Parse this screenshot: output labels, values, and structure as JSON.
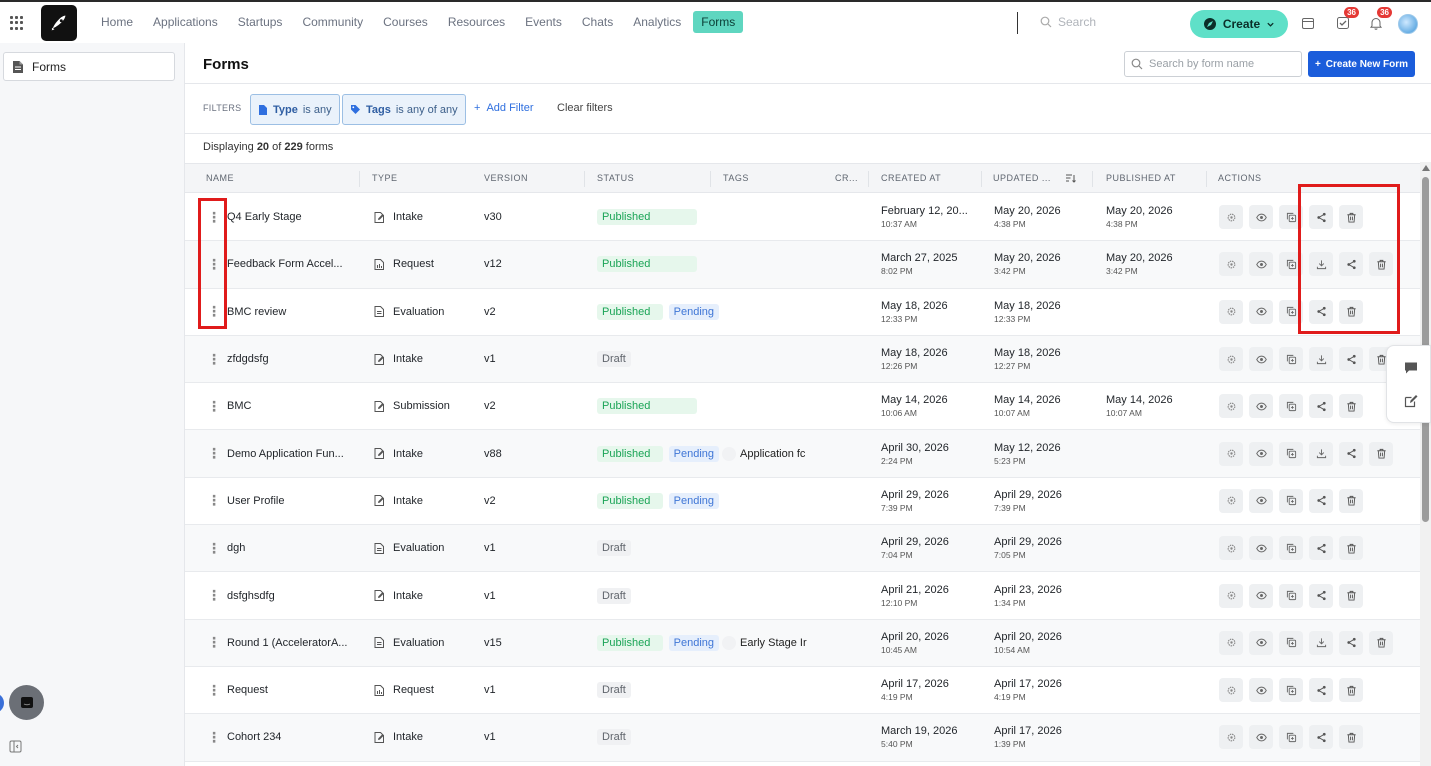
{
  "topbar": {
    "nav": [
      "Home",
      "Applications",
      "Startups",
      "Community",
      "Courses",
      "Resources",
      "Events",
      "Chats",
      "Analytics",
      "Forms"
    ],
    "active_nav": "Forms",
    "search_placeholder": "Search",
    "create_label": "Create",
    "tasks_badge": "36",
    "notifications_badge": "36"
  },
  "sidebar": {
    "items": [
      {
        "label": "Forms"
      }
    ]
  },
  "page": {
    "title": "Forms",
    "search_placeholder": "Search by form name",
    "create_new_label": "Create New Form"
  },
  "filters": {
    "label": "FILTERS",
    "type_key": "Type",
    "type_rest": "is any",
    "tags_key": "Tags",
    "tags_rest": "is any of any",
    "add_filter": "Add Filter",
    "clear_filters": "Clear filters"
  },
  "display": {
    "prefix": "Displaying",
    "shown": "20",
    "of": "of",
    "total": "229",
    "suffix": "forms"
  },
  "columns": [
    "NAME",
    "TYPE",
    "VERSION",
    "STATUS",
    "TAGS",
    "CR...",
    "CREATED AT",
    "UPDATED ...",
    "PUBLISHED AT",
    "ACTIONS"
  ],
  "rows": [
    {
      "name": "Q4 Early Stage",
      "type": "Intake",
      "version": "v30",
      "status": [
        "Published"
      ],
      "tag": "",
      "created": [
        "February 12, 20...",
        "10:37 AM"
      ],
      "updated": [
        "May 20, 2026",
        "4:38 PM"
      ],
      "published": [
        "May 20, 2026",
        "4:38 PM"
      ],
      "download": false
    },
    {
      "name": "Feedback Form Accel...",
      "type": "Request",
      "version": "v12",
      "status": [
        "Published"
      ],
      "tag": "",
      "created": [
        "March 27, 2025",
        "8:02 PM"
      ],
      "updated": [
        "May 20, 2026",
        "3:42 PM"
      ],
      "published": [
        "May 20, 2026",
        "3:42 PM"
      ],
      "download": true
    },
    {
      "name": "BMC review",
      "type": "Evaluation",
      "version": "v2",
      "status": [
        "Published",
        "Pending"
      ],
      "tag": "",
      "created": [
        "May 18, 2026",
        "12:33 PM"
      ],
      "updated": [
        "May 18, 2026",
        "12:33 PM"
      ],
      "published": [
        "",
        ""
      ],
      "download": false
    },
    {
      "name": "zfdgdsfg",
      "type": "Intake",
      "version": "v1",
      "status": [
        "Draft"
      ],
      "tag": "",
      "created": [
        "May 18, 2026",
        "12:26 PM"
      ],
      "updated": [
        "May 18, 2026",
        "12:27 PM"
      ],
      "published": [
        "",
        ""
      ],
      "download": true
    },
    {
      "name": "BMC",
      "type": "Submission",
      "version": "v2",
      "status": [
        "Published"
      ],
      "tag": "",
      "created": [
        "May 14, 2026",
        "10:06 AM"
      ],
      "updated": [
        "May 14, 2026",
        "10:07 AM"
      ],
      "published": [
        "May 14, 2026",
        "10:07 AM"
      ],
      "download": false
    },
    {
      "name": "Demo Application Fun...",
      "type": "Intake",
      "version": "v88",
      "status": [
        "Published",
        "Pending"
      ],
      "tag": "Application fc",
      "created": [
        "April 30, 2026",
        "2:24 PM"
      ],
      "updated": [
        "May 12, 2026",
        "5:23 PM"
      ],
      "published": [
        "",
        ""
      ],
      "download": true
    },
    {
      "name": "User Profile",
      "type": "Intake",
      "version": "v2",
      "status": [
        "Published",
        "Pending"
      ],
      "tag": "",
      "created": [
        "April 29, 2026",
        "7:39 PM"
      ],
      "updated": [
        "April 29, 2026",
        "7:39 PM"
      ],
      "published": [
        "",
        ""
      ],
      "download": false
    },
    {
      "name": "dgh",
      "type": "Evaluation",
      "version": "v1",
      "status": [
        "Draft"
      ],
      "tag": "",
      "created": [
        "April 29, 2026",
        "7:04 PM"
      ],
      "updated": [
        "April 29, 2026",
        "7:05 PM"
      ],
      "published": [
        "",
        ""
      ],
      "download": false
    },
    {
      "name": "dsfghsdfg",
      "type": "Intake",
      "version": "v1",
      "status": [
        "Draft"
      ],
      "tag": "",
      "created": [
        "April 21, 2026",
        "12:10 PM"
      ],
      "updated": [
        "April 23, 2026",
        "1:34 PM"
      ],
      "published": [
        "",
        ""
      ],
      "download": false
    },
    {
      "name": "Round 1 (AcceleratorA...",
      "type": "Evaluation",
      "version": "v15",
      "status": [
        "Published",
        "Pending"
      ],
      "tag": "Early Stage Ir",
      "created": [
        "April 20, 2026",
        "10:45 AM"
      ],
      "updated": [
        "April 20, 2026",
        "10:54 AM"
      ],
      "published": [
        "",
        ""
      ],
      "download": true
    },
    {
      "name": "Request",
      "type": "Request",
      "version": "v1",
      "status": [
        "Draft"
      ],
      "tag": "",
      "created": [
        "April 17, 2026",
        "4:19 PM"
      ],
      "updated": [
        "April 17, 2026",
        "4:19 PM"
      ],
      "published": [
        "",
        ""
      ],
      "download": false
    },
    {
      "name": "Cohort 234",
      "type": "Intake",
      "version": "v1",
      "status": [
        "Draft"
      ],
      "tag": "",
      "created": [
        "March 19, 2026",
        "5:40 PM"
      ],
      "updated": [
        "April 17, 2026",
        "1:39 PM"
      ],
      "published": [
        "",
        ""
      ],
      "download": false
    }
  ],
  "colors": {
    "accent": "#5fd6c0",
    "primary": "#1b5ddb",
    "published": "#1aa456",
    "pending": "#3f76d6",
    "highlight": "#e01b1b"
  }
}
